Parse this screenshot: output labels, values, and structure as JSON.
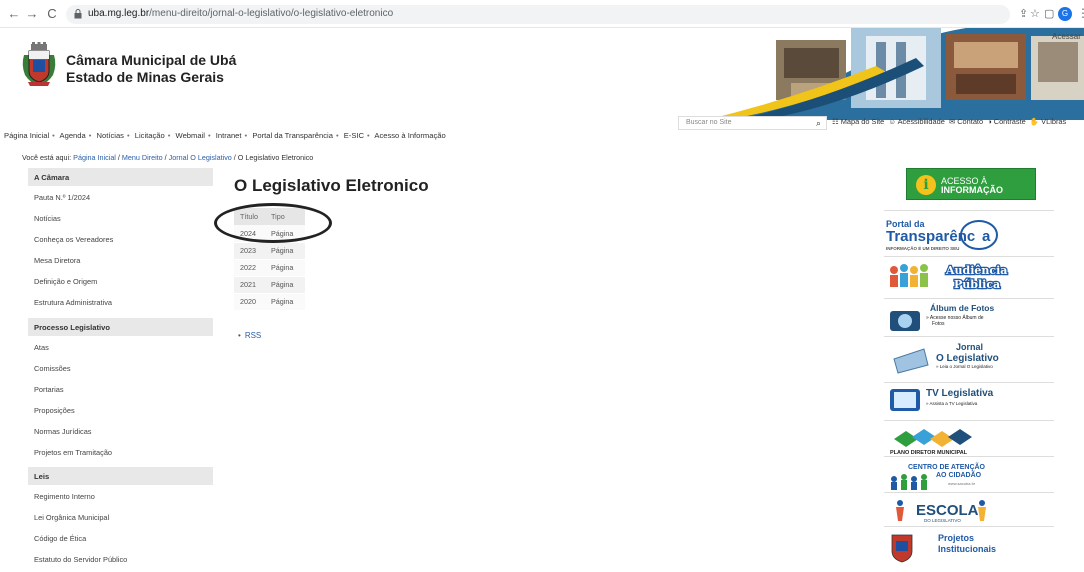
{
  "browser": {
    "back": "←",
    "forward": "→",
    "reload": "C",
    "url_host": "uba.mg.leg.br",
    "url_path": "/menu-direito/jornal-o-legislativo/o-legislativo-eletronico",
    "profile_initial": "G"
  },
  "header": {
    "title_line1": "Câmara Municipal de Ubá",
    "title_line2": "Estado de Minas Gerais",
    "acessar": "Acessar"
  },
  "topnav": {
    "items": [
      "Página Inicial",
      "Agenda",
      "Notícias",
      "Licitação",
      "Webmail",
      "Intranet",
      "Portal da Transparência",
      "E-SIC",
      "Acesso à Informação"
    ]
  },
  "search": {
    "placeholder": "Buscar no Site"
  },
  "access_links": {
    "mapa": "Mapa do Site",
    "acessibilidade": "Acessibilidade",
    "contato": "Contato",
    "contraste": "Contraste",
    "vlibras": "VLibras"
  },
  "breadcrumb": {
    "prefix": "Você está aqui:",
    "home": "Página Inicial",
    "sep": "/",
    "menu": "Menu Direito",
    "jornal": "Jornal O Legislativo",
    "current": "O Legislativo Eletronico"
  },
  "sidebar": {
    "camara_heading": "A Câmara",
    "camara_items": [
      "Pauta N.º 1/2024",
      "Notícias",
      "Conheça os Vereadores",
      "Mesa Diretora",
      "Definição e Origem",
      "Estrutura Administrativa"
    ],
    "processo_heading": "Processo Legislativo",
    "processo_items": [
      "Atas",
      "Comissões",
      "Portarias",
      "Proposições",
      "Normas Jurídicas",
      "Projetos em Tramitação"
    ],
    "leis_heading": "Leis",
    "leis_items": [
      "Regimento Interno",
      "Lei Orgânica Municipal",
      "Código de Ética",
      "Estatuto do Servidor Público"
    ]
  },
  "main": {
    "title": "O Legislativo Eletronico",
    "table": {
      "col_titulo": "Título",
      "col_tipo": "Tipo",
      "rows": [
        {
          "titulo": "2024",
          "tipo": "Página"
        },
        {
          "titulo": "2023",
          "tipo": "Página"
        },
        {
          "titulo": "2022",
          "tipo": "Página"
        },
        {
          "titulo": "2021",
          "tipo": "Página"
        },
        {
          "titulo": "2020",
          "tipo": "Página"
        }
      ]
    },
    "rss": "RSS"
  },
  "right": {
    "acesso_line1": "ACESSO À",
    "acesso_line2": "INFORMAÇÃO",
    "portal_line1": "Portal da",
    "portal_line2": "Transparênc",
    "portal_line2_end": "a",
    "portal_sub": "INFORMAÇÃO É UM DIREITO SEU",
    "audiencia_line1": "Audiência",
    "audiencia_line2": "Pública",
    "album_title": "Álbum de Fotos",
    "album_sub1": "» Acesse nosso Álbum de",
    "album_sub2": "Fotos",
    "jornal_line1": "Jornal",
    "jornal_line2": "O Legislativo",
    "jornal_sub": "» Leia o Jornal O Legislativo",
    "tv_title": "TV Legislativa",
    "tv_sub": "» Assista a TV Legislativa",
    "plano": "PLANO DIRETOR MUNICIPAL",
    "centro_line1": "CENTRO DE ATENÇÃO",
    "centro_line2": "AO CIDADÃO",
    "centro_sub": "www.sacuba.br",
    "escola_line1": "ESCOLA",
    "escola_line2": "DO LEGISLATIVO",
    "projetos_line1": "Projetos",
    "projetos_line2": "Institucionais"
  },
  "colors": {
    "acesso_green": "#2f9e3f",
    "link_blue": "#2a5ea8",
    "sidebar_heading_bg": "#e8e8e8"
  }
}
